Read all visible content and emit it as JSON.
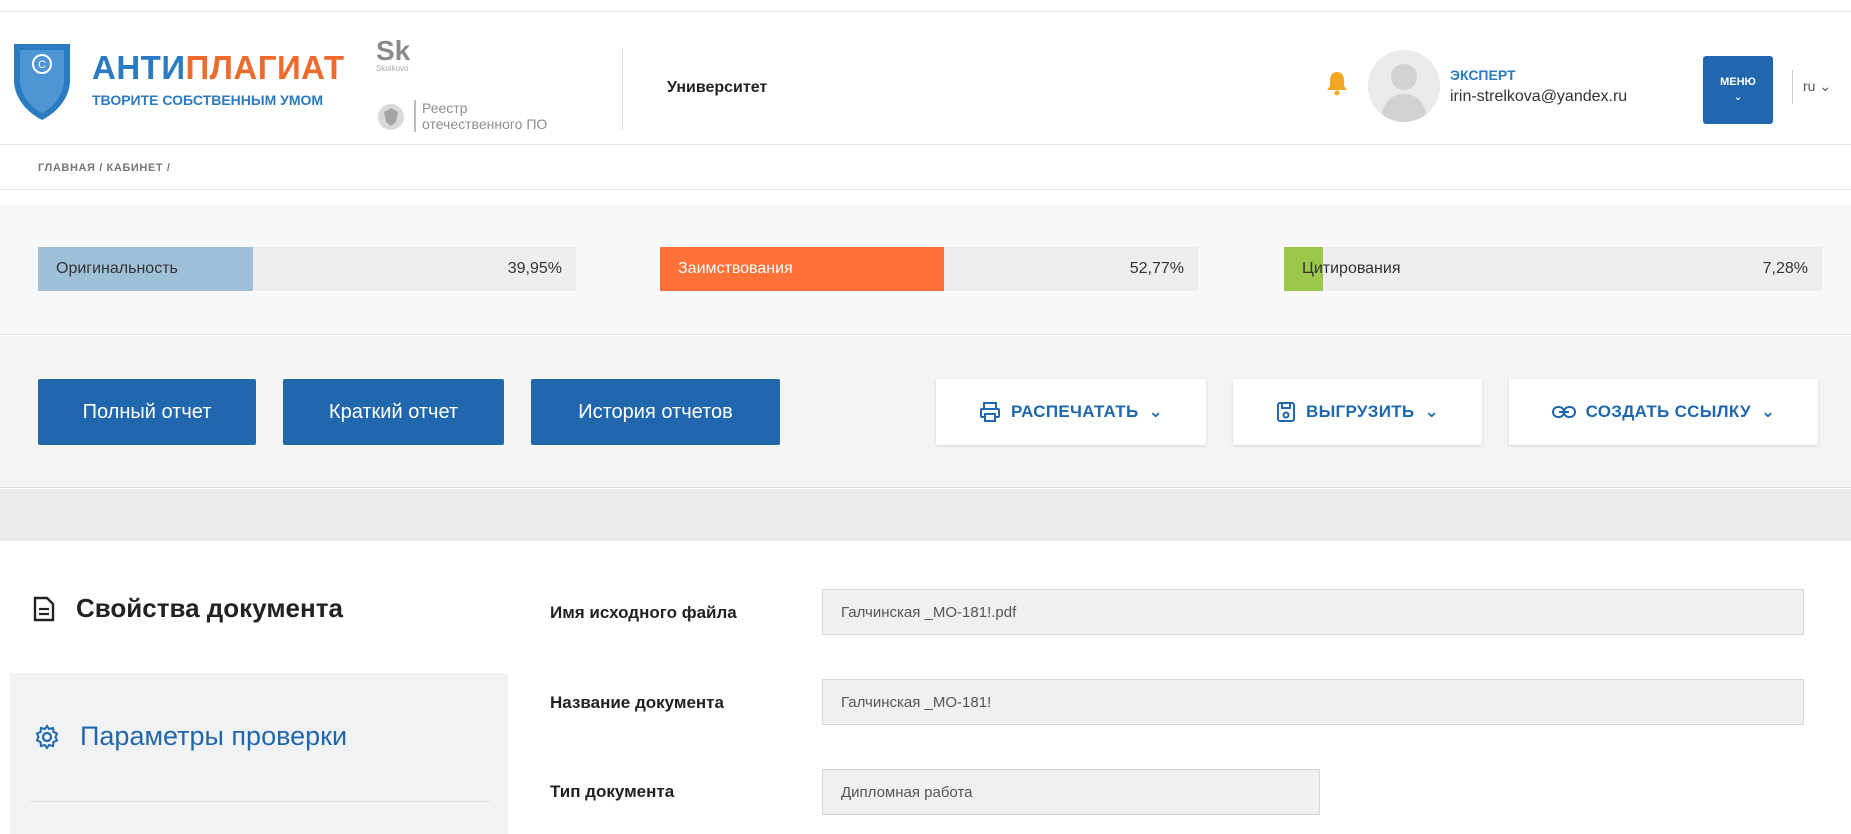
{
  "header": {
    "logo_title_part1": "АНТИ",
    "logo_title_part2": "ПЛАГИАТ",
    "logo_tagline": "ТВОРИТЕ СОБСТВЕННЫМ УМОМ",
    "sk_mark": "Sk",
    "sk_small": "Skolkovo",
    "reestr_line1": "Реестр",
    "reestr_line2": "отечественного ПО",
    "organization": "Университет",
    "user_role": "ЭКСПЕРТ",
    "user_email": "irin-strelkova@yandex.ru",
    "menu_label": "МЕНЮ",
    "language": "ru ⌄"
  },
  "breadcrumb": "ГЛАВНАЯ / КАБИНЕТ /",
  "stats": {
    "originality": {
      "label": "Оригинальность",
      "value": "39,95%",
      "percent": 39.95,
      "color": "#9fc0d9"
    },
    "borrowings": {
      "label": "Заимствования",
      "value": "52,77%",
      "percent": 52.77,
      "color": "#ff7137"
    },
    "citations": {
      "label": "Цитирования",
      "value": "7,28%",
      "percent": 7.28,
      "color": "#9bc84a"
    }
  },
  "actions": {
    "full_report": "Полный отчет",
    "short_report": "Краткий отчет",
    "report_history": "История отчетов",
    "print": "РАСПЕЧАТАТЬ",
    "export": "ВЫГРУЗИТЬ",
    "create_link": "СОЗДАТЬ ССЫЛКУ"
  },
  "sidebar": {
    "items": [
      {
        "label": "Свойства документа",
        "icon": "document-icon",
        "active": true
      },
      {
        "label": "Параметры проверки",
        "icon": "gear-icon",
        "active": false
      }
    ]
  },
  "properties": {
    "source_file_label": "Имя исходного файла",
    "source_file_value": "Галчинская _МО-181!.pdf",
    "doc_name_label": "Название документа",
    "doc_name_value": "Галчинская _МО-181!",
    "doc_type_label": "Тип документа",
    "doc_type_value": "Дипломная работа"
  },
  "colors": {
    "brand_blue": "#2067ae",
    "brand_orange": "#f06a2d"
  }
}
